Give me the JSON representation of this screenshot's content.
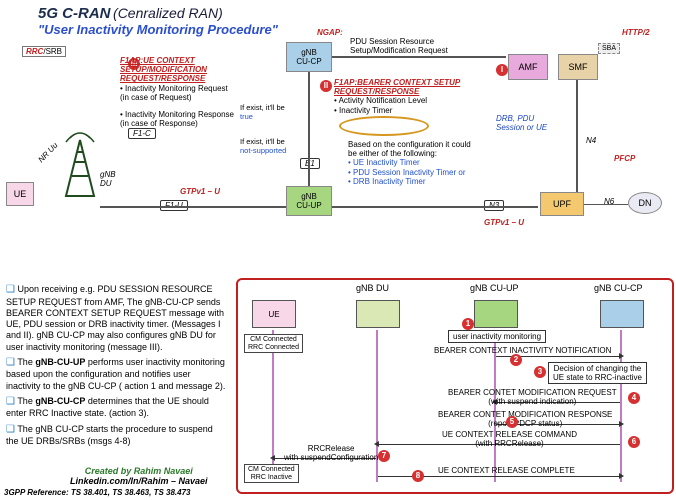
{
  "title": {
    "main": "5G C-RAN",
    "paren": "(Cenralized RAN)",
    "subtitle": "\"User Inactivity Monitoring Procedure\""
  },
  "protocols": {
    "ngap": "NGAP:",
    "http2": "HTTP/2",
    "rrc_srb": "RRC/SRB",
    "pfcp": "PFCP",
    "gtpv1u_top": "GTPv1 – U",
    "gtpv1u_bot": "GTPv1 – U",
    "nr_uu": "NR Uu"
  },
  "interfaces": {
    "f1c": "F1-C",
    "f1u": "F1-U",
    "e1": "E1",
    "n3": "N3",
    "n4": "N4",
    "n6": "N6",
    "sba": "SBA"
  },
  "nodes": {
    "ue": "UE",
    "gnb_du": "gNB\nDU",
    "gnb_cucp": "gNB\nCU-CP",
    "gnb_cuup": "gNB\nCU-UP",
    "amf": "AMF",
    "smf": "SMF",
    "upf": "UPF",
    "dn": "DN"
  },
  "ngap_msg": "PDU Session Resource\nSetup/Modification Request",
  "tags": {
    "I": "I",
    "II": "II",
    "III": "III"
  },
  "f1ap_block": {
    "title": "F1AP:UE CONTEXT\nSETUP/MODIFICATION\nREQUEST/RESPONSE",
    "b1": "Inactivity Monitoring Request\n(in case of Request)",
    "b2": "Inactivity Monitoring Response\n(in case of Response)",
    "h1": "If exist, it'll be\ntrue",
    "h2": "If exist, it'll be\nnot-supported"
  },
  "e1ap_block": {
    "title": "F1AP:BEARER CONTEXT SETUP\nREQUEST/RESPONSE",
    "b1": "Activity Notification Level",
    "b2": "Inactivity Timer",
    "hint": "DRB, PDU\nSession or UE",
    "cfg_intro": "Based on the configuration it could\nbe either of the following:",
    "cfg1": "UE Inactivity Timer",
    "cfg2": "PDU Session Inactivity Timer or",
    "cfg3": "DRB Inactivity Timer"
  },
  "seq_actors": {
    "ue": "UE",
    "du": "gNB DU",
    "cuup": "gNB CU-UP",
    "cucp": "gNB CU-CP"
  },
  "seq_notes": {
    "cm_conn": "CM Connected\nRRC Connected",
    "cm_inact": "CM Connected\nRRC Inactive"
  },
  "seq_msgs": {
    "m1": "user inactivity monitoring",
    "m2": "BEARER CONTEXT INACTIVITY  NOTIFICATION",
    "m3": "Decision of changing the\nUE state to RRC-inactive",
    "m4": "BEARER CONTET MODIFICATION REQUEST\n(with suspend indication)",
    "m5": "BEARER CONTET MODIFICATION  RESPONSE\n(report PDCP status)",
    "m6": "UE CONTEXT RELEASE COMMAND\n(with RRCRelease)",
    "m7": "RRCRelease\nwith suspendConfiguration",
    "m8": "UE CONTEXT RELEASE COMPLETE"
  },
  "seq_nums": {
    "n1": "1",
    "n2": "2",
    "n3": "3",
    "n4": "4",
    "n5": "5",
    "n6": "6",
    "n7": "7",
    "n8": "8"
  },
  "bullets": {
    "p1": "Upon receiving e.g. PDU SESSION RESOURCE SETUP REQUEST from AMF, The gNB-CU-CP sends BEARER CONTEXT SETUP REQUEST message with UE, PDU session or DRB inactivity timer. (Messages I and II). gNB CU-CP may also configures gNB DU for user inactivity monitoring (message III).",
    "p2_a": "The ",
    "p2_b": "gNB-CU-UP",
    "p2_c": " performs user inactivity monitoring based upon the configuration and notifies user inactivity to the gNB CU-CP ( action 1 and message 2).",
    "p3_a": "The ",
    "p3_b": "gNB-CU-CP",
    "p3_c": " determines that the UE should enter RRC Inactive state. (action 3).",
    "p4": "The gNB CU-CP starts the procedure to suspend the UE DRBs/SRBs (msgs 4-8)"
  },
  "author": {
    "by": "Created by Rahim Navaei",
    "ln": "Linkedin.com/In/Rahim – Navaei"
  },
  "ref": "3GPP Reference: TS 38.401, TS 38.463, TS 38.473"
}
